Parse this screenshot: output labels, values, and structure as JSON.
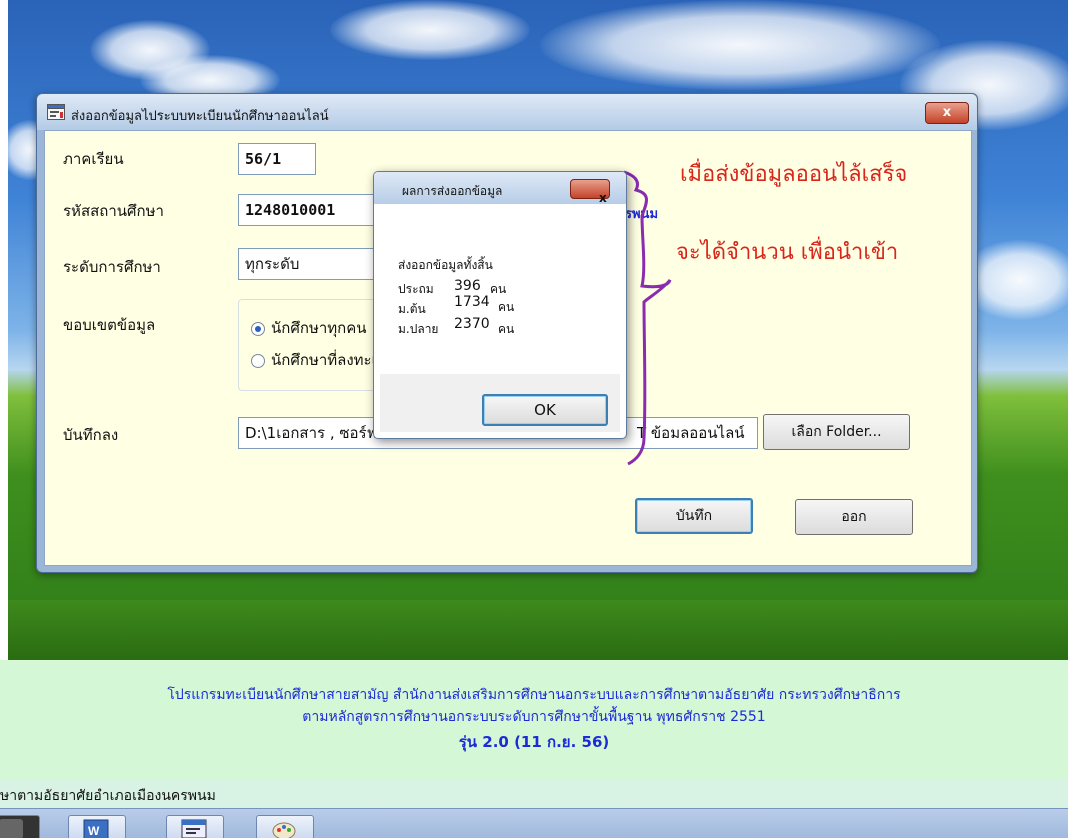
{
  "window": {
    "title": "ส่งออกข้อมูลไประบบทะเบียนนักศึกษาออนไลน์",
    "close": "x"
  },
  "form": {
    "semester_label": "ภาคเรียน",
    "semester_value": "56/1",
    "school_code_label": "รหัสสถานศึกษา",
    "school_code_value": "1248010001",
    "school_name_fragment": "รพนม",
    "level_label": "ระดับการศึกษา",
    "level_value": "ทุกระดับ",
    "scope_label": "ขอบเขตข้อมูล",
    "scope_option_all": "นักศึกษาทุกคน",
    "scope_option_registered": "นักศึกษาที่ลงทะเ",
    "save_to_label": "บันทึกลง",
    "save_path_left": "D:\\1เอกสาร , ซอร์ฟแว",
    "save_path_right": "T ข้อมลออนไลน์",
    "choose_folder_button": "เลือก Folder...",
    "save_button": "บันทึก",
    "exit_button": "ออก"
  },
  "dialog": {
    "title": "ผลการส่งออกข้อมูล",
    "close": "x",
    "heading": "ส่งออกข้อมูลทั้งสิ้น",
    "rows": [
      {
        "level": "ประถม",
        "count": "396",
        "unit": "คน"
      },
      {
        "level": "ม.ต้น",
        "count": "1734",
        "unit": "คน"
      },
      {
        "level": "ม.ปลาย",
        "count": "2370",
        "unit": "คน"
      }
    ],
    "ok_button": "OK"
  },
  "annotations": {
    "line1": "เมื่อส่งข้อมูลออนไล้เสร็จ",
    "line2": "จะได้จำนวน  เพื่อนำเข้า"
  },
  "footer": {
    "line1": "โปรแกรมทะเบียนนักศึกษาสายสามัญ สำนักงานส่งเสริมการศึกษานอกระบบและการศึกษาตามอัธยาศัย กระทรวงศึกษาธิการ",
    "line2": "ตามหลักสูตรการศึกษานอกระบบระดับการศึกษาขั้นพื้นฐาน พุทธศักราช 2551",
    "version": "รุ่น 2.0 (11 ก.ย. 56)"
  },
  "status": {
    "text": "ษาตามอัธยาศัยอำเภอเมืองนครพนม"
  },
  "colors": {
    "annotation": "#d8261c",
    "bracket": "#8a2bb0",
    "footer_text": "#1d2bd6"
  },
  "taskbar_icons": [
    "app-icon",
    "word-icon",
    "form-icon",
    "paint-icon"
  ]
}
